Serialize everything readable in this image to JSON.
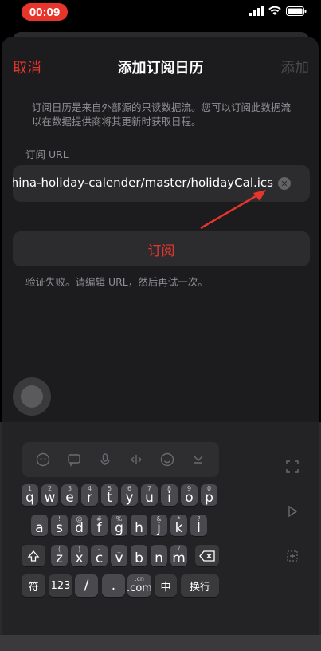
{
  "status": {
    "time": "00:09"
  },
  "nav": {
    "cancel": "取消",
    "title": "添加订阅日历",
    "add": "添加"
  },
  "form": {
    "description": "订阅日历是来自外部源的只读数据流。您可以订阅此数据流以在数据提供商将其更新时获取日程。",
    "url_label": "订阅 URL",
    "url_value": "s/china-holiday-calender/master/holidayCal.ics",
    "subscribe": "订阅",
    "error": "验证失败。请编辑 URL，然后再试一次。"
  },
  "accent": "#e8352c",
  "keyboard": {
    "row1": [
      {
        "k": "q",
        "s": "1"
      },
      {
        "k": "w",
        "s": "2"
      },
      {
        "k": "e",
        "s": "3"
      },
      {
        "k": "r",
        "s": "4"
      },
      {
        "k": "t",
        "s": "5"
      },
      {
        "k": "y",
        "s": "6"
      },
      {
        "k": "u",
        "s": "7"
      },
      {
        "k": "i",
        "s": "8"
      },
      {
        "k": "o",
        "s": "9"
      },
      {
        "k": "p",
        "s": "0"
      }
    ],
    "row2": [
      {
        "k": "a",
        "s": "~"
      },
      {
        "k": "s",
        "s": "!"
      },
      {
        "k": "d",
        "s": "@"
      },
      {
        "k": "f",
        "s": "#"
      },
      {
        "k": "g",
        "s": "%"
      },
      {
        "k": "h",
        "s": "'"
      },
      {
        "k": "j",
        "s": "&"
      },
      {
        "k": "k",
        "s": "*"
      },
      {
        "k": "l",
        "s": "?"
      }
    ],
    "row3": [
      {
        "k": "z",
        "s": "("
      },
      {
        "k": "x",
        "s": ")"
      },
      {
        "k": "c",
        "s": "-"
      },
      {
        "k": "v",
        "s": "_"
      },
      {
        "k": "b",
        "s": ":"
      },
      {
        "k": "n",
        "s": ";"
      },
      {
        "k": "m",
        "s": "/"
      }
    ],
    "row4": {
      "sym": "符",
      "num": "123",
      "slash": "/",
      "dot": ".",
      "com": ".com",
      "com_sup": ".cn",
      "zh": "中",
      "enter": "换行"
    }
  }
}
